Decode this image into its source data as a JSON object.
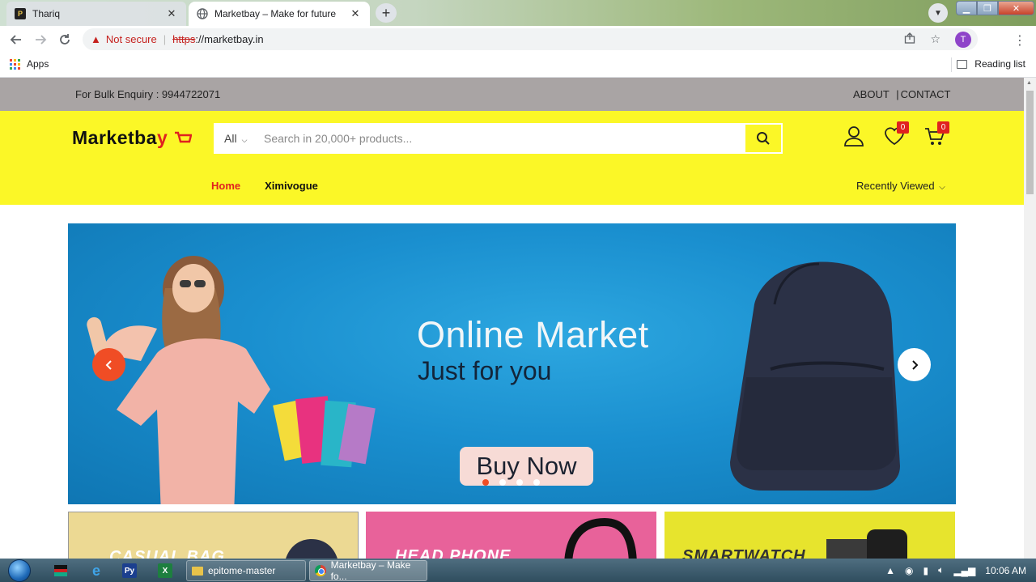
{
  "browser": {
    "tabs": [
      {
        "title": "Thariq",
        "active": false
      },
      {
        "title": "Marketbay – Make for future",
        "active": true
      }
    ],
    "address": {
      "warning": "Not secure",
      "scheme": "https",
      "rest": "://marketbay.in"
    },
    "profile_initial": "T",
    "bookmarks": {
      "apps_label": "Apps",
      "reading_list_label": "Reading list"
    }
  },
  "page": {
    "topbar": {
      "bulk_enquiry": "For Bulk Enquiry : 9944722071",
      "about": "ABOUT",
      "divider": "|",
      "contact": "CONTACT"
    },
    "header": {
      "logo_main": "Marketba",
      "logo_accent": "y",
      "search_category": "All",
      "search_placeholder": "Search in 20,000+ products...",
      "wishlist_count": "0",
      "cart_count": "0"
    },
    "nav": {
      "home": "Home",
      "ximivogue": "Ximivogue",
      "recently_viewed": "Recently Viewed"
    },
    "hero": {
      "title": "Online Market",
      "subtitle": "Just for you",
      "cta": "Buy Now",
      "slide_count": 4,
      "active_slide": 1
    },
    "tiles": [
      {
        "label": "CASUAL BAG"
      },
      {
        "label": "HEAD PHONE"
      },
      {
        "label": "SMARTWATCH"
      }
    ]
  },
  "taskbar": {
    "tasks": [
      "epitome-master",
      "Marketbay – Make fo..."
    ],
    "time": "10:06 AM"
  },
  "colors": {
    "header_yellow": "#fbf727",
    "accent_red": "#e0221f",
    "topbar_gray": "#a9a4a4",
    "hero_blue": "#1a8fcf",
    "arrow_orange": "#f04d25"
  }
}
